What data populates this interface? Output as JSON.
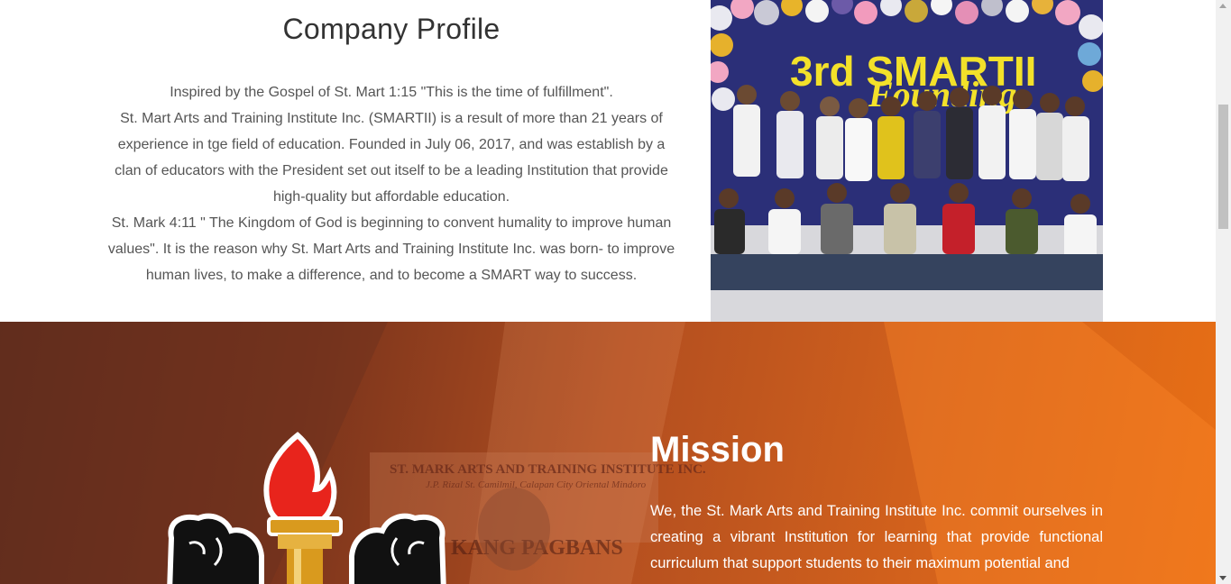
{
  "profile": {
    "title": "Company Profile",
    "para1": "Inspired by the Gospel of St. Mart 1:15 \"This is the time of fulfillment\".",
    "para2": "St. Mart Arts and Training Institute Inc. (SMARTII) is a result of more than 21 years of experience in tge field of education. Founded in July 06, 2017, and was establish by a clan of educators with the President set out itself to be a leading Institution that provide high-quality but affordable education.",
    "para3": "St. Mark 4:11 \" The Kingdom of God is beginning to convent humality to improve human values\". It is the reason why St. Mart Arts and Training Institute Inc. was born- to improve human lives, to make a difference, and to become a SMART way to success.",
    "photo_banner_line1": "3rd SMARTII",
    "photo_banner_line2": "Founding"
  },
  "mission": {
    "title": "Mission",
    "text": "We, the St. Mark Arts and Training Institute Inc. commit ourselves in creating a vibrant Institution for learning that provide functional curriculum that support students to their maximum potential and",
    "bg_sign_line1": "ST. MARK ARTS AND TRAINING INSTITUTE INC.",
    "bg_sign_line2": "J.P. Rizal St. Camilmil, Calapan City Oriental Mindoro",
    "bg_banner": "KANG PAGBANS"
  },
  "colors": {
    "mission_orange": "#e86f15",
    "mission_dark": "#5a2a1d",
    "torch_flame": "#e8241c",
    "torch_gold": "#d99a1e"
  }
}
